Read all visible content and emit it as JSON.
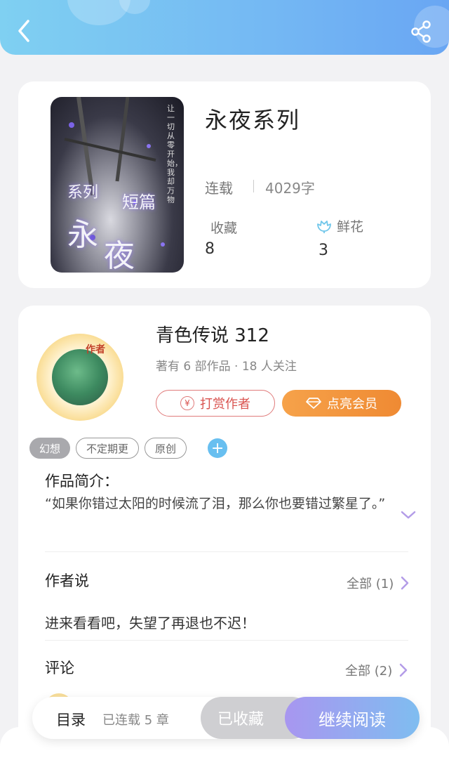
{
  "book": {
    "title": "永夜系列",
    "status": "连载",
    "word_count": "4029字",
    "favorites_label": "收藏",
    "favorites_value": "8",
    "flowers_label": "鲜花",
    "flowers_value": "3",
    "cover_text": {
      "big1": "永",
      "big2": "夜",
      "small1": "系列",
      "small2": "短篇",
      "vertical": "让一切从零开始，我却万物"
    }
  },
  "author": {
    "name": "青色传说 312",
    "meta": "著有 6 部作品 · 18 人关注",
    "avatar_badge": "作者",
    "tip_label": "打赏作者",
    "vip_label": "点亮会员"
  },
  "tags": [
    "幻想",
    "不定期更",
    "原创"
  ],
  "intro": {
    "title": "作品简介：",
    "text": "“如果你错过太阳的时候流了泪，那么你也要错过繁星了。”"
  },
  "author_says": {
    "title": "作者说",
    "more": "全部 (1)",
    "text": "进来看看吧，失望了再退也不迟！"
  },
  "comments": {
    "title": "评论",
    "more": "全部 (2)"
  },
  "bottom_bar": {
    "toc": "目录",
    "chapters": "已连载 5 章",
    "collected": "已收藏",
    "continue": "继续阅读"
  },
  "icons": {
    "back": "back-arrow-icon",
    "share": "share-icon",
    "flower": "flower-icon",
    "yen": "yen-icon",
    "diamond": "diamond-icon",
    "plus": "plus-icon",
    "chevron_down": "chevron-down-icon",
    "chevron_right": "chevron-right-icon"
  },
  "colors": {
    "header_start": "#7fd0f2",
    "header_end": "#69a6f3",
    "accent_purple": "#a896f0",
    "tip_red": "#d9534f",
    "vip_orange": "#ef8a33"
  }
}
